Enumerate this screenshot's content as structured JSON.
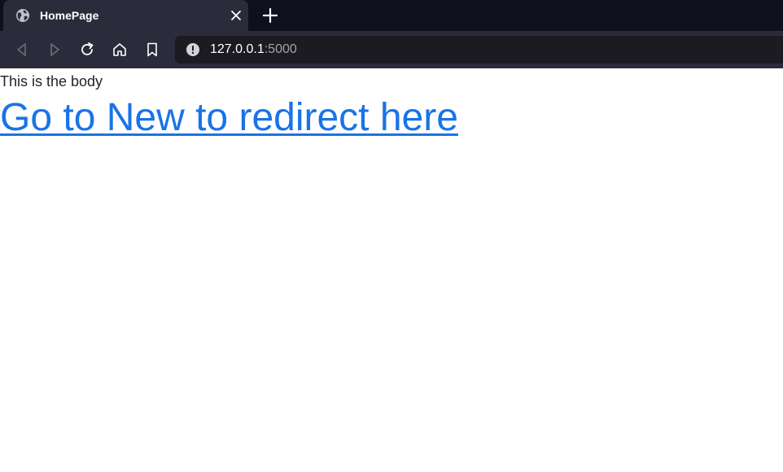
{
  "browser": {
    "tab": {
      "title": "HomePage",
      "favicon": "globe-icon",
      "close_icon": "close-icon"
    },
    "new_tab_icon": "plus-icon",
    "toolbar": {
      "back_icon": "back-arrow-icon",
      "forward_icon": "forward-arrow-icon",
      "reload_icon": "reload-icon",
      "home_icon": "home-icon",
      "bookmark_icon": "bookmark-icon"
    },
    "urlbar": {
      "info_icon": "info-icon",
      "host": "127.0.0.1",
      "port": ":5000"
    },
    "colors": {
      "tabstrip_bg": "#0f0f1e",
      "toolbar_bg": "#2b2c3b",
      "urlbar_bg": "#1c1b22",
      "link": "#1a73e8"
    }
  },
  "page": {
    "body_text": "This is the body",
    "link_text": "Go to New to redirect here"
  }
}
